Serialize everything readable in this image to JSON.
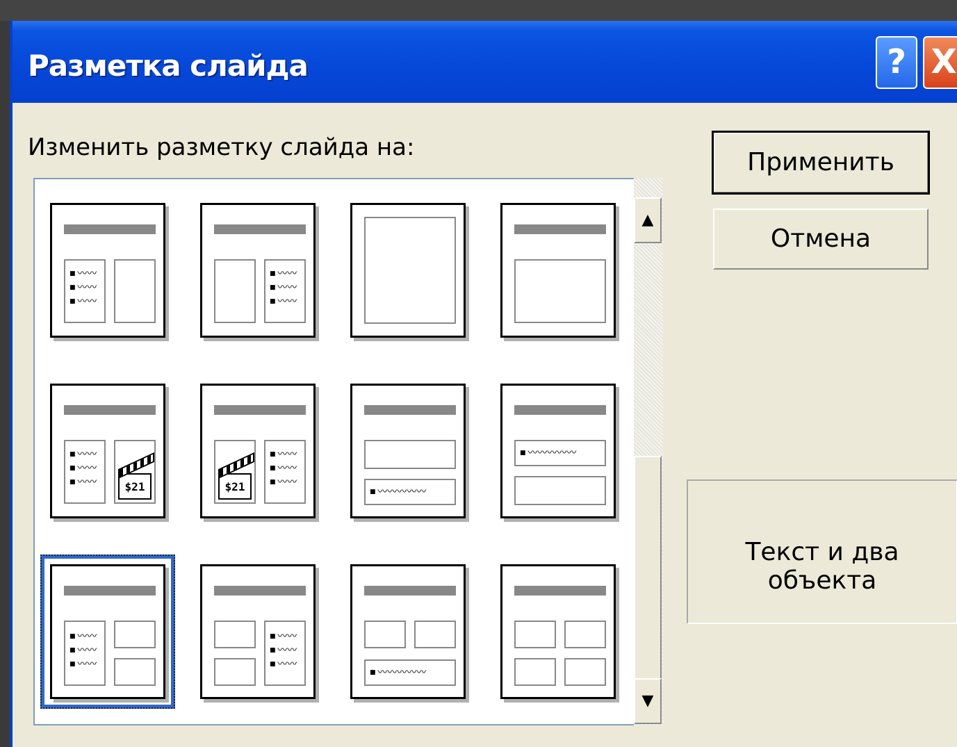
{
  "window": {
    "title": "Разметка слайда",
    "help_label": "?",
    "close_label": "X"
  },
  "dialog": {
    "prompt_label": "Изменить разметку слайда на:",
    "apply_label": "Применить",
    "cancel_label": "Отмена",
    "preview_text": "Текст и два объекта"
  },
  "scrollbar": {
    "up_glyph": "▲",
    "down_glyph": "▼"
  },
  "layouts": [
    {
      "name": "text-and-content"
    },
    {
      "name": "content-and-text"
    },
    {
      "name": "content"
    },
    {
      "name": "title-and-content"
    },
    {
      "name": "text-and-media-clip"
    },
    {
      "name": "media-clip-and-text"
    },
    {
      "name": "content-over-text"
    },
    {
      "name": "text-over-content"
    },
    {
      "name": "text-and-two-content",
      "selected": true
    },
    {
      "name": "two-content-and-text"
    },
    {
      "name": "two-content-over-text"
    },
    {
      "name": "four-content"
    }
  ],
  "clip_label": "$21",
  "colors": {
    "titlebar": "#0648d8",
    "dialog_bg": "#ece9d8",
    "selection": "#3168c8"
  }
}
